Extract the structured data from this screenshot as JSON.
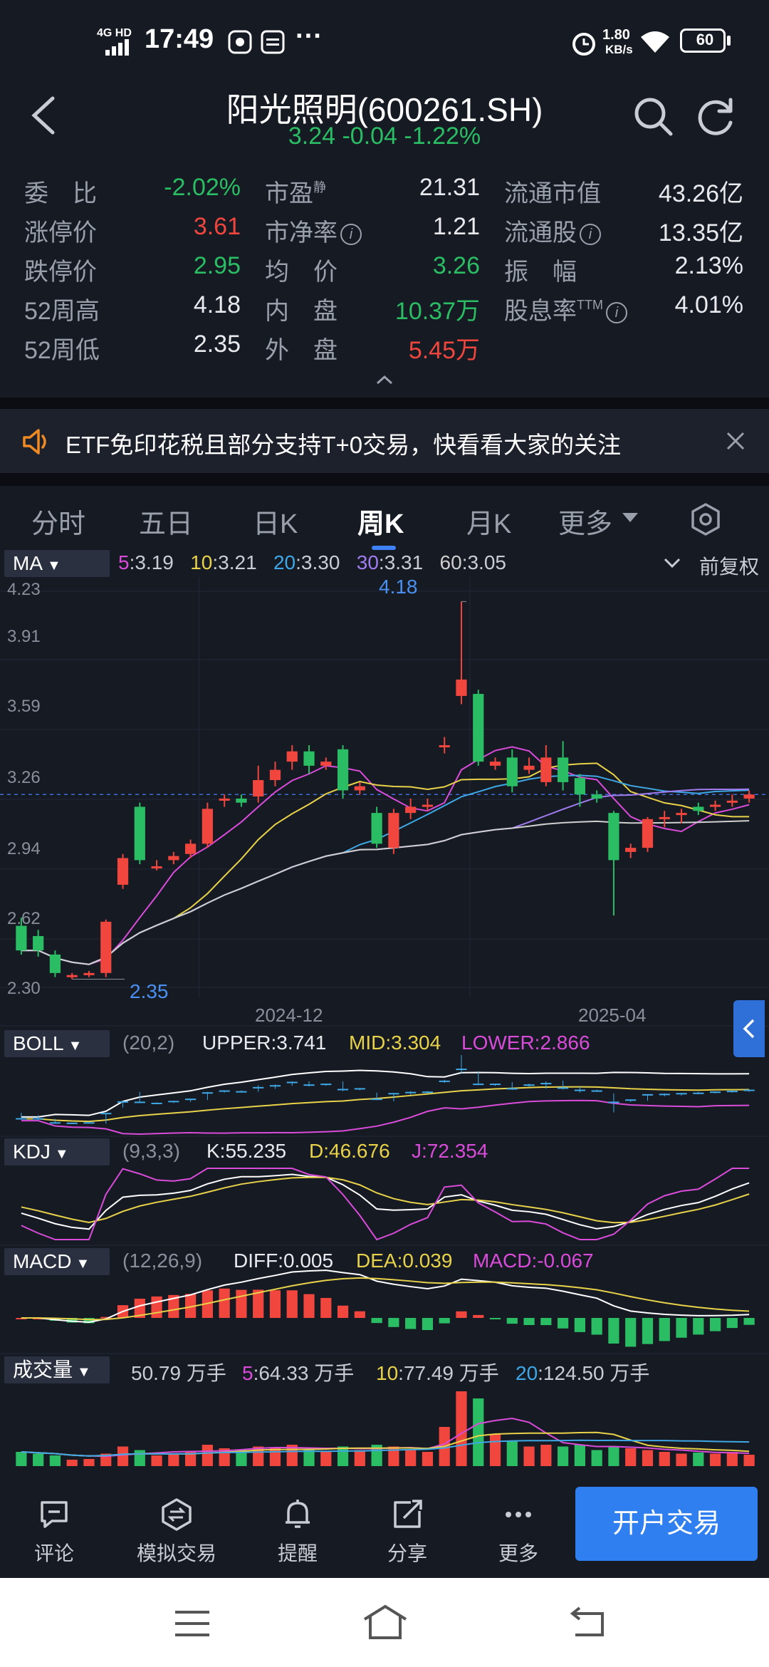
{
  "status_bar": {
    "network": "4G HD",
    "time": "17:49",
    "net_speed_value": "1.80",
    "net_speed_unit": "KB/s",
    "battery": "60"
  },
  "header": {
    "title": "阳光照明(600261.SH)",
    "subtitle": "3.24 -0.04 -1.22%"
  },
  "stats": {
    "rows": [
      [
        {
          "label": "委　比",
          "value": "-2.02%"
        },
        {
          "label": "市盈",
          "sup": "静",
          "value": "21.31"
        },
        {
          "label": "流通市值",
          "value": "43.26亿"
        }
      ],
      [
        {
          "label": "涨停价",
          "value": "3.61"
        },
        {
          "label": "市净率",
          "value": "1.21"
        },
        {
          "label": "流通股",
          "value": "13.35亿"
        }
      ],
      [
        {
          "label": "跌停价",
          "value": "2.95"
        },
        {
          "label": "均　价",
          "value": "3.26"
        },
        {
          "label": "振　幅",
          "value": "2.13%"
        }
      ],
      [
        {
          "label": "52周高",
          "value": "4.18"
        },
        {
          "label": "内　盘",
          "value": "10.37万"
        },
        {
          "label": "股息率",
          "sup": "TTM",
          "value": "4.01%"
        }
      ],
      [
        {
          "label": "52周低",
          "value": "2.35"
        },
        {
          "label": "外　盘",
          "value": "5.45万"
        }
      ]
    ]
  },
  "notice": {
    "text": "ETF免印花税且部分支持T+0交易，快看看大家的关注"
  },
  "tabs": [
    "分时",
    "五日",
    "日K",
    "周K",
    "月K",
    "更多"
  ],
  "active_tab": "周K",
  "ma_bar": {
    "button": "MA",
    "ma5_key": "5",
    "ma5_val": ":3.19",
    "ma10_key": "10",
    "ma10_val": ":3.21",
    "ma20_key": "20",
    "ma20_val": ":3.30",
    "ma30_key": "30",
    "ma30_val": ":3.31",
    "ma60_key": "60",
    "ma60_val": ":3.05",
    "adjust": "前复权"
  },
  "price_axis": [
    "4.23",
    "3.91",
    "3.59",
    "3.26",
    "2.94",
    "2.62",
    "2.30"
  ],
  "annotations": {
    "high": "4.18",
    "low": "2.35"
  },
  "date_axis": [
    "2024-12",
    "2025-04"
  ],
  "boll": {
    "button": "BOLL",
    "params": "(20,2)",
    "upper": "UPPER:3.741",
    "mid": "MID:3.304",
    "lower": "LOWER:2.866"
  },
  "kdj": {
    "button": "KDJ",
    "params": "(9,3,3)",
    "k": "K:55.235",
    "d": "D:46.676",
    "j": "J:72.354"
  },
  "macd": {
    "button": "MACD",
    "params": "(12,26,9)",
    "diff": "DIFF:0.005",
    "dea": "DEA:0.039",
    "macd": "MACD:-0.067"
  },
  "volume": {
    "button": "成交量",
    "current": "50.79 万手",
    "ma5_key": "5",
    "ma5_val": ":64.33 万手",
    "ma10_key": "10",
    "ma10_val": ":77.49 万手",
    "ma20_key": "20",
    "ma20_val": ":124.50 万手"
  },
  "bottom_bar": {
    "items": [
      "评论",
      "模拟交易",
      "提醒",
      "分享",
      "更多"
    ],
    "trade_button": "开户交易"
  },
  "colors": {
    "up": "#f0463e",
    "down": "#2bbd63",
    "accent": "#2f7ff0",
    "ma5": "#d94bd9",
    "ma10": "#e8d24a",
    "ma20": "#3ea8e6",
    "ma30": "#a07cf0",
    "ma60": "#cfcfcf"
  },
  "chart_data": {
    "type": "candlestick",
    "period": "weekly",
    "candles": [
      {
        "o": 2.6,
        "c": 2.48,
        "h": 2.64,
        "l": 2.46
      },
      {
        "o": 2.55,
        "c": 2.48,
        "h": 2.58,
        "l": 2.45
      },
      {
        "o": 2.46,
        "c": 2.37,
        "h": 2.48,
        "l": 2.35
      },
      {
        "o": 2.35,
        "c": 2.36,
        "h": 2.37,
        "l": 2.34
      },
      {
        "o": 2.36,
        "c": 2.37,
        "h": 2.38,
        "l": 2.35
      },
      {
        "o": 2.37,
        "c": 2.62,
        "h": 2.63,
        "l": 2.35
      },
      {
        "o": 2.8,
        "c": 2.93,
        "h": 2.95,
        "l": 2.78
      },
      {
        "o": 3.18,
        "c": 2.92,
        "h": 3.2,
        "l": 2.9
      },
      {
        "o": 2.88,
        "c": 2.89,
        "h": 2.92,
        "l": 2.87
      },
      {
        "o": 2.92,
        "c": 2.94,
        "h": 2.96,
        "l": 2.9
      },
      {
        "o": 2.95,
        "c": 3.0,
        "h": 3.02,
        "l": 2.93
      },
      {
        "o": 3.0,
        "c": 3.17,
        "h": 3.2,
        "l": 2.98
      },
      {
        "o": 3.21,
        "c": 3.22,
        "h": 3.24,
        "l": 3.18
      },
      {
        "o": 3.22,
        "c": 3.2,
        "h": 3.24,
        "l": 3.18
      },
      {
        "o": 3.23,
        "c": 3.31,
        "h": 3.38,
        "l": 3.2
      },
      {
        "o": 3.31,
        "c": 3.36,
        "h": 3.4,
        "l": 3.28
      },
      {
        "o": 3.4,
        "c": 3.45,
        "h": 3.48,
        "l": 3.36
      },
      {
        "o": 3.45,
        "c": 3.38,
        "h": 3.48,
        "l": 3.34
      },
      {
        "o": 3.38,
        "c": 3.4,
        "h": 3.42,
        "l": 3.36
      },
      {
        "o": 3.46,
        "c": 3.26,
        "h": 3.48,
        "l": 3.22
      },
      {
        "o": 3.26,
        "c": 3.28,
        "h": 3.3,
        "l": 3.24
      },
      {
        "o": 3.15,
        "c": 3.0,
        "h": 3.18,
        "l": 2.98
      },
      {
        "o": 2.98,
        "c": 3.15,
        "h": 3.17,
        "l": 2.95
      },
      {
        "o": 3.15,
        "c": 3.18,
        "h": 3.22,
        "l": 3.12
      },
      {
        "o": 3.18,
        "c": 3.19,
        "h": 3.22,
        "l": 3.16
      },
      {
        "o": 3.47,
        "c": 3.48,
        "h": 3.52,
        "l": 3.44
      },
      {
        "o": 3.72,
        "c": 3.8,
        "h": 4.18,
        "l": 3.68
      },
      {
        "o": 3.73,
        "c": 3.4,
        "h": 3.75,
        "l": 3.38
      },
      {
        "o": 3.38,
        "c": 3.4,
        "h": 3.42,
        "l": 3.36
      },
      {
        "o": 3.42,
        "c": 3.28,
        "h": 3.46,
        "l": 3.25
      },
      {
        "o": 3.36,
        "c": 3.38,
        "h": 3.42,
        "l": 3.34
      },
      {
        "o": 3.3,
        "c": 3.42,
        "h": 3.48,
        "l": 3.28
      },
      {
        "o": 3.42,
        "c": 3.3,
        "h": 3.5,
        "l": 3.26
      },
      {
        "o": 3.32,
        "c": 3.24,
        "h": 3.34,
        "l": 3.18
      },
      {
        "o": 3.24,
        "c": 3.22,
        "h": 3.26,
        "l": 3.2
      },
      {
        "o": 3.15,
        "c": 2.92,
        "h": 3.16,
        "l": 2.65
      },
      {
        "o": 2.96,
        "c": 2.98,
        "h": 3.0,
        "l": 2.93
      },
      {
        "o": 2.98,
        "c": 3.12,
        "h": 3.13,
        "l": 2.96
      },
      {
        "o": 3.12,
        "c": 3.13,
        "h": 3.16,
        "l": 3.08
      },
      {
        "o": 3.14,
        "c": 3.15,
        "h": 3.17,
        "l": 3.1
      },
      {
        "o": 3.18,
        "c": 3.16,
        "h": 3.2,
        "l": 3.14
      },
      {
        "o": 3.18,
        "c": 3.19,
        "h": 3.21,
        "l": 3.16
      },
      {
        "o": 3.2,
        "c": 3.21,
        "h": 3.24,
        "l": 3.18
      },
      {
        "o": 3.22,
        "c": 3.24,
        "h": 3.26,
        "l": 3.2
      }
    ],
    "volume": [
      40,
      35,
      30,
      18,
      20,
      35,
      55,
      45,
      30,
      35,
      40,
      60,
      50,
      45,
      55,
      50,
      60,
      45,
      40,
      55,
      45,
      60,
      55,
      45,
      40,
      110,
      210,
      190,
      90,
      70,
      55,
      60,
      55,
      60,
      45,
      55,
      50,
      45,
      40,
      35,
      38,
      35,
      40,
      32
    ],
    "ylim": [
      2.3,
      4.23
    ]
  }
}
